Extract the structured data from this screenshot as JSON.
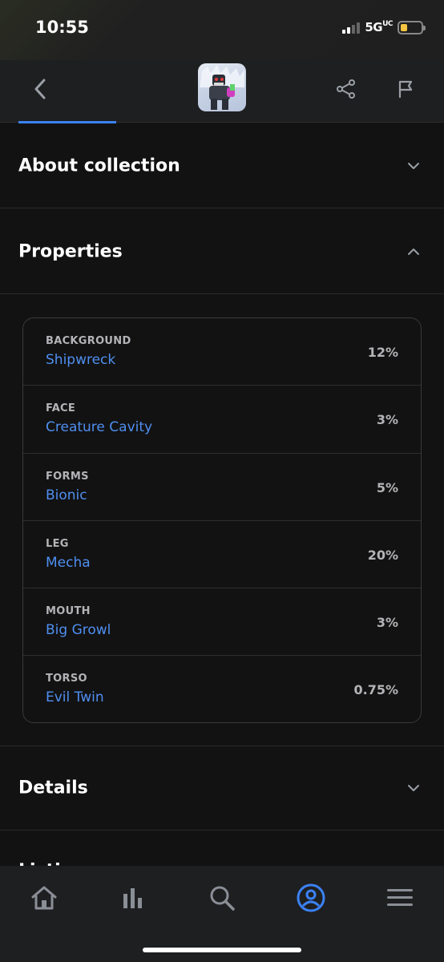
{
  "status": {
    "time": "10:55",
    "network": "5G"
  },
  "sections": {
    "about": "About collection",
    "properties": "Properties",
    "details": "Details",
    "partial": "Listings"
  },
  "properties": [
    {
      "type": "BACKGROUND",
      "value": "Shipwreck",
      "percent": "12%"
    },
    {
      "type": "FACE",
      "value": "Creature Cavity",
      "percent": "3%"
    },
    {
      "type": "FORMS",
      "value": "Bionic",
      "percent": "5%"
    },
    {
      "type": "LEG",
      "value": "Mecha",
      "percent": "20%"
    },
    {
      "type": "MOUTH",
      "value": "Big Growl",
      "percent": "3%"
    },
    {
      "type": "TORSO",
      "value": "Evil Twin",
      "percent": "0.75%"
    }
  ],
  "tabs": [
    "home-icon",
    "stats-icon",
    "search-icon",
    "profile-icon",
    "menu-icon"
  ],
  "colors": {
    "accent": "#3b82f6",
    "link": "#4f8ff0",
    "background": "#121212"
  }
}
